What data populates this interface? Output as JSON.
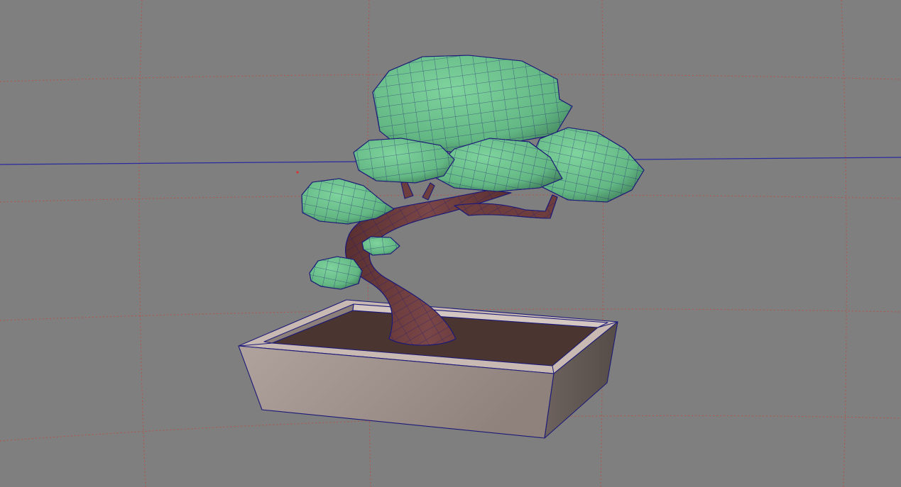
{
  "viewport": {
    "background": "#7f7f7f",
    "grid_color": "#b0554a",
    "horizon_color": "#2a2aa0"
  },
  "model": {
    "wireframe_color": "#1c1a78",
    "foliage_color": "#6cc48e",
    "trunk_color": "#6e3d3d",
    "pot_color": "#a2928b",
    "soil_color": "#4b3531"
  }
}
